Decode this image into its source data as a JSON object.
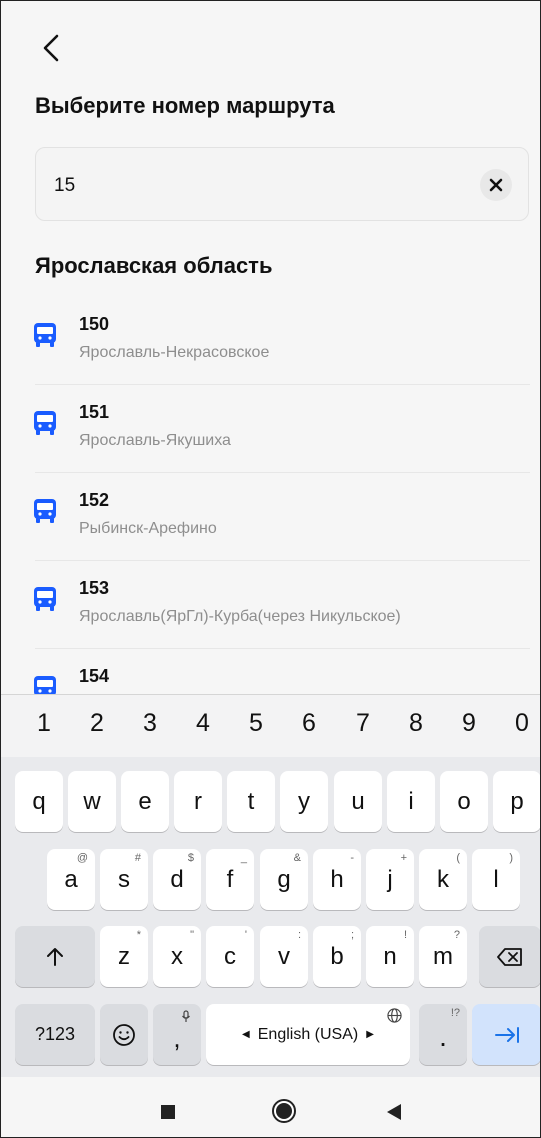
{
  "header": {
    "title": "Выберите номер маршрута"
  },
  "search": {
    "value": "15",
    "placeholder": ""
  },
  "region": "Ярославская область",
  "routes": [
    {
      "number": "150",
      "name": "Ярославль-Некрасовское"
    },
    {
      "number": "151",
      "name": "Ярославль-Якушиха"
    },
    {
      "number": "152",
      "name": "Рыбинск-Арефино"
    },
    {
      "number": "153",
      "name": "Ярославль(ЯрГл)-Курба(через Никульское)"
    },
    {
      "number": "154",
      "name": ""
    }
  ],
  "keyboard": {
    "numbers": [
      "1",
      "2",
      "3",
      "4",
      "5",
      "6",
      "7",
      "8",
      "9",
      "0"
    ],
    "row1": [
      "q",
      "w",
      "e",
      "r",
      "t",
      "y",
      "u",
      "i",
      "o",
      "p"
    ],
    "row2": [
      "a",
      "s",
      "d",
      "f",
      "g",
      "h",
      "j",
      "k",
      "l"
    ],
    "row2_hints": [
      "@",
      "#",
      "$",
      "_",
      "&",
      "-",
      "+",
      "(",
      ")"
    ],
    "row3": [
      "z",
      "x",
      "c",
      "v",
      "b",
      "n",
      "m"
    ],
    "row3_hints": [
      "*",
      "\"",
      "'",
      ":",
      ";",
      "!",
      "?"
    ],
    "symbols_label": "?123",
    "comma": ",",
    "period": ".",
    "period_hint": "!?",
    "space_label": "English (USA)"
  },
  "colors": {
    "accent": "#1a5cff",
    "enter": "#1a73e8"
  }
}
